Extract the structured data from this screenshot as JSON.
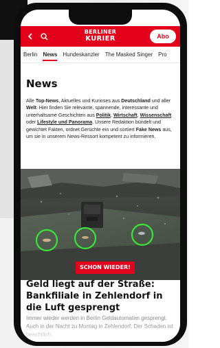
{
  "header": {
    "logo_line1": "BERLINER",
    "logo_line2": "KURIER",
    "abo_label": "Abo",
    "back_icon": "chevron-left-icon",
    "search_icon": "search-icon"
  },
  "tabs": [
    {
      "label": "Berlin"
    },
    {
      "label": "News",
      "active": true
    },
    {
      "label": "Hundeskanzler"
    },
    {
      "label": "The Masked Singer"
    },
    {
      "label": "Pro"
    }
  ],
  "page": {
    "title": "News",
    "intro": {
      "p1": "Alle ",
      "b1": "Top-News",
      "p2": ", Aktuelles und Kurioses aus ",
      "b2": "Deutschland",
      "p3": " und aller ",
      "b3": "Welt",
      "p4": ": Hier finden Sie relevante, spannende, interessante und unterhaltsame Geschichten aus ",
      "u1": "Politik",
      "p5": ", ",
      "u2": "Wirtschaft",
      "p6": ", ",
      "u3": "Wissenschaft",
      "p7": " oder ",
      "u4": "Lifestyle und Panorama",
      "p8": ". Unsere Redaktion bündelt und gewichtet Fakten, ordnet Gerüchte ein und sortiert ",
      "b4": "Fake News",
      "p9": " aus, um sie in unserem News-Ressort kompetent zu informieren."
    }
  },
  "article": {
    "badge": "SCHON WIEDER!",
    "headline": "Geld liegt auf der Straße: Bankfiliale in Zehlendorf in die Luft gesprengt",
    "teaser": "Immer wieder werden in Berlin Geldautomaten gesprengt. Auch in der Nacht zu Montag in Zehlendorf. Der Schaden ist beachtlich."
  },
  "colors": {
    "brand_red": "#e2001a",
    "highlight_circle": "#39e639"
  }
}
